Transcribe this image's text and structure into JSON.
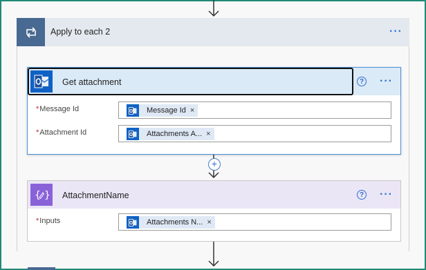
{
  "loop": {
    "title": "Apply to each 2",
    "icon": "loop-icon",
    "more_label": "···"
  },
  "get_attachment": {
    "title": "Get attachment",
    "icon": "outlook-icon",
    "help_label": "?",
    "more_label": "···",
    "fields": [
      {
        "required_mark": "*",
        "label": "Message Id",
        "token": "Message Id",
        "token_remove": "×"
      },
      {
        "required_mark": "*",
        "label": "Attachment Id",
        "token": "Attachments A...",
        "token_remove": "×"
      }
    ]
  },
  "add_step": {
    "label": "+"
  },
  "attachment_name": {
    "title": "AttachmentName",
    "icon": "variable-icon",
    "help_label": "?",
    "more_label": "···",
    "fields": [
      {
        "required_mark": "*",
        "label": "Inputs",
        "token": "Attachments N...",
        "token_remove": "×"
      }
    ]
  },
  "colors": {
    "frame_border": "#1f8a78",
    "loop_accent": "#486991",
    "outlook_blue": "#0f62c4",
    "compose_purple": "#8a62d8",
    "link_blue": "#2f6fd0"
  }
}
